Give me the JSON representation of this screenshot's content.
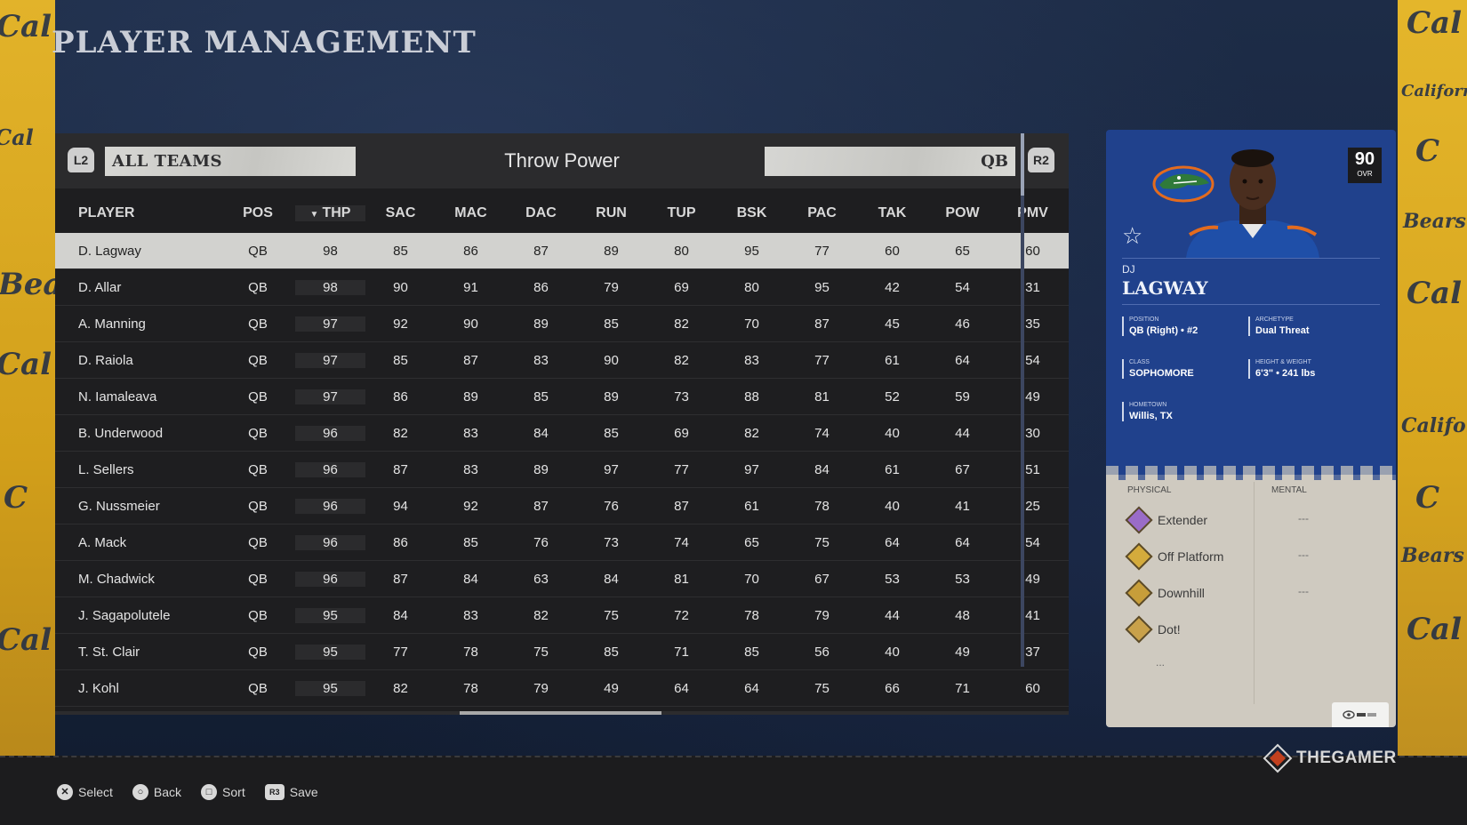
{
  "page": {
    "title": "PLAYER MANAGEMENT"
  },
  "filters": {
    "left_bumper": "L2",
    "team": "ALL TEAMS",
    "sort_label": "Throw Power",
    "position": "QB",
    "right_bumper": "R2"
  },
  "table": {
    "columns": [
      "PLAYER",
      "POS",
      "THP",
      "SAC",
      "MAC",
      "DAC",
      "RUN",
      "TUP",
      "BSK",
      "PAC",
      "TAK",
      "POW",
      "PMV"
    ],
    "sorted_column": "THP",
    "rows": [
      [
        "D. Lagway",
        "QB",
        "98",
        "85",
        "86",
        "87",
        "89",
        "80",
        "95",
        "77",
        "60",
        "65",
        "60"
      ],
      [
        "D. Allar",
        "QB",
        "98",
        "90",
        "91",
        "86",
        "79",
        "69",
        "80",
        "95",
        "42",
        "54",
        "31"
      ],
      [
        "A. Manning",
        "QB",
        "97",
        "92",
        "90",
        "89",
        "85",
        "82",
        "70",
        "87",
        "45",
        "46",
        "35"
      ],
      [
        "D. Raiola",
        "QB",
        "97",
        "85",
        "87",
        "83",
        "90",
        "82",
        "83",
        "77",
        "61",
        "64",
        "54"
      ],
      [
        "N. Iamaleava",
        "QB",
        "97",
        "86",
        "89",
        "85",
        "89",
        "73",
        "88",
        "81",
        "52",
        "59",
        "49"
      ],
      [
        "B. Underwood",
        "QB",
        "96",
        "82",
        "83",
        "84",
        "85",
        "69",
        "82",
        "74",
        "40",
        "44",
        "30"
      ],
      [
        "L. Sellers",
        "QB",
        "96",
        "87",
        "83",
        "89",
        "97",
        "77",
        "97",
        "84",
        "61",
        "67",
        "51"
      ],
      [
        "G. Nussmeier",
        "QB",
        "96",
        "94",
        "92",
        "87",
        "76",
        "87",
        "61",
        "78",
        "40",
        "41",
        "25"
      ],
      [
        "A. Mack",
        "QB",
        "96",
        "86",
        "85",
        "76",
        "73",
        "74",
        "65",
        "75",
        "64",
        "64",
        "54"
      ],
      [
        "M. Chadwick",
        "QB",
        "96",
        "87",
        "84",
        "63",
        "84",
        "81",
        "70",
        "67",
        "53",
        "53",
        "49"
      ],
      [
        "J. Sagapolutele",
        "QB",
        "95",
        "84",
        "83",
        "82",
        "75",
        "72",
        "78",
        "79",
        "44",
        "48",
        "41"
      ],
      [
        "T. St. Clair",
        "QB",
        "95",
        "77",
        "78",
        "75",
        "85",
        "71",
        "85",
        "56",
        "40",
        "49",
        "37"
      ],
      [
        "J. Kohl",
        "QB",
        "95",
        "82",
        "78",
        "79",
        "49",
        "64",
        "64",
        "75",
        "66",
        "71",
        "60"
      ]
    ]
  },
  "card": {
    "ovr_value": "90",
    "ovr_label": "OVR",
    "first_name": "DJ",
    "last_name": "LAGWAY",
    "position_label": "POSITION",
    "position_value": "QB (Right) • #2",
    "archetype_label": "ARCHETYPE",
    "archetype_value": "Dual Threat",
    "class_label": "CLASS",
    "class_value": "SOPHOMORE",
    "hw_label": "HEIGHT & WEIGHT",
    "hw_value": "6'3\" • 241 lbs",
    "hometown_label": "HOMETOWN",
    "hometown_value": "Willis, TX",
    "physical_label": "PHYSICAL",
    "mental_label": "MENTAL",
    "abilities": [
      "Extender",
      "Off Platform",
      "Downhill",
      "Dot!"
    ],
    "mental_placeholder": "---",
    "more_placeholder": "...",
    "colors": {
      "card_blue": "#20418c",
      "jersey_blue": "#1f4fa8",
      "gator_orange": "#e36b1e"
    }
  },
  "background_words": [
    "Cal",
    "California",
    "Bears",
    "C"
  ],
  "watermark": "THEGAMER",
  "controls": [
    {
      "icon": "✕",
      "label": "Select"
    },
    {
      "icon": "○",
      "label": "Back"
    },
    {
      "icon": "□",
      "label": "Sort"
    },
    {
      "icon": "R3",
      "label": "Save"
    }
  ]
}
